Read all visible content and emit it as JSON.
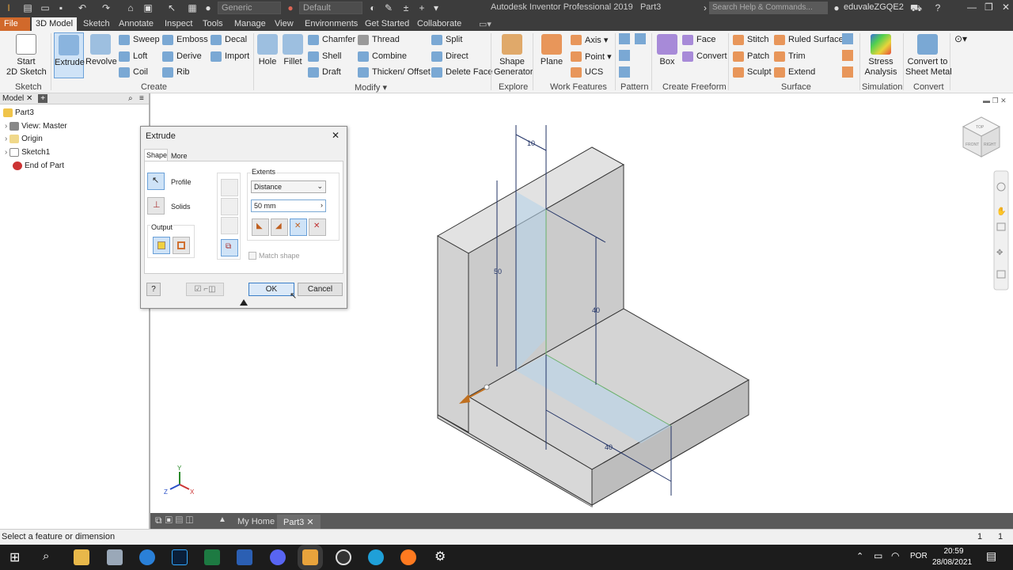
{
  "titlebar": {
    "appearance_combo": "Generic",
    "material_combo": "Default",
    "app_title": "Autodesk Inventor Professional 2019",
    "doc_title": "Part3",
    "search_placeholder": "Search Help & Commands...",
    "user": "eduvaleZGQE2"
  },
  "tabs": [
    "File",
    "3D Model",
    "Sketch",
    "Annotate",
    "Inspect",
    "Tools",
    "Manage",
    "View",
    "Environments",
    "Get Started",
    "Collaborate"
  ],
  "ribbon": {
    "sketch": {
      "start_line1": "Start",
      "start_line2": "2D Sketch",
      "panel": "Sketch"
    },
    "create": {
      "extrude": "Extrude",
      "revolve": "Revolve",
      "sweep": "Sweep",
      "loft": "Loft",
      "coil": "Coil",
      "emboss": "Emboss",
      "derive": "Derive",
      "rib": "Rib",
      "decal": "Decal",
      "import": "Import",
      "panel": "Create"
    },
    "modify": {
      "hole": "Hole",
      "fillet": "Fillet",
      "chamfer": "Chamfer",
      "shell": "Shell",
      "draft": "Draft",
      "thread": "Thread",
      "combine": "Combine",
      "thicken": "Thicken/ Offset",
      "split": "Split",
      "direct": "Direct",
      "delete_face": "Delete Face",
      "panel": "Modify"
    },
    "explore": {
      "shape_gen_1": "Shape",
      "shape_gen_2": "Generator",
      "panel": "Explore"
    },
    "work": {
      "plane": "Plane",
      "axis": "Axis",
      "point": "Point",
      "ucs": "UCS",
      "panel": "Work Features"
    },
    "pattern": {
      "panel": "Pattern"
    },
    "freeform": {
      "box": "Box",
      "face": "Face",
      "convert": "Convert",
      "panel": "Create Freeform"
    },
    "surface": {
      "stitch": "Stitch",
      "patch": "Patch",
      "sculpt": "Sculpt",
      "ruled": "Ruled Surface",
      "trim": "Trim",
      "extend": "Extend",
      "panel": "Surface"
    },
    "simulation": {
      "stress_1": "Stress",
      "stress_2": "Analysis",
      "panel": "Simulation"
    },
    "convert": {
      "sm_1": "Convert to",
      "sm_2": "Sheet Metal",
      "panel": "Convert"
    }
  },
  "browser": {
    "tab": "Model",
    "items": [
      "Part3",
      "View: Master",
      "Origin",
      "Sketch1",
      "End of Part"
    ]
  },
  "dialog": {
    "title": "Extrude",
    "tabs": [
      "Shape",
      "More"
    ],
    "profile": "Profile",
    "solids": "Solids",
    "output": "Output",
    "extents": "Extents",
    "extent_type": "Distance",
    "distance": "50 mm",
    "match_shape": "Match shape",
    "ok": "OK",
    "cancel": "Cancel"
  },
  "dimensions": {
    "d10": "10",
    "d50": "50",
    "d40a": "40",
    "d40b": "40"
  },
  "viewcube": {
    "top": "TOP",
    "front": "FRONT",
    "right": "RIGHT"
  },
  "axes": {
    "x": "X",
    "y": "Y",
    "z": "Z"
  },
  "doc_tabs": {
    "home": "My Home",
    "part": "Part3"
  },
  "status": {
    "text": "Select a feature or dimension",
    "n1": "1",
    "n2": "1"
  },
  "taskbar": {
    "lang": "POR",
    "time": "20:59",
    "date": "28/08/2021"
  },
  "colors": {
    "accent": "#d1692b",
    "dark": "#3c3c3c",
    "select": "#cfe3f7"
  }
}
